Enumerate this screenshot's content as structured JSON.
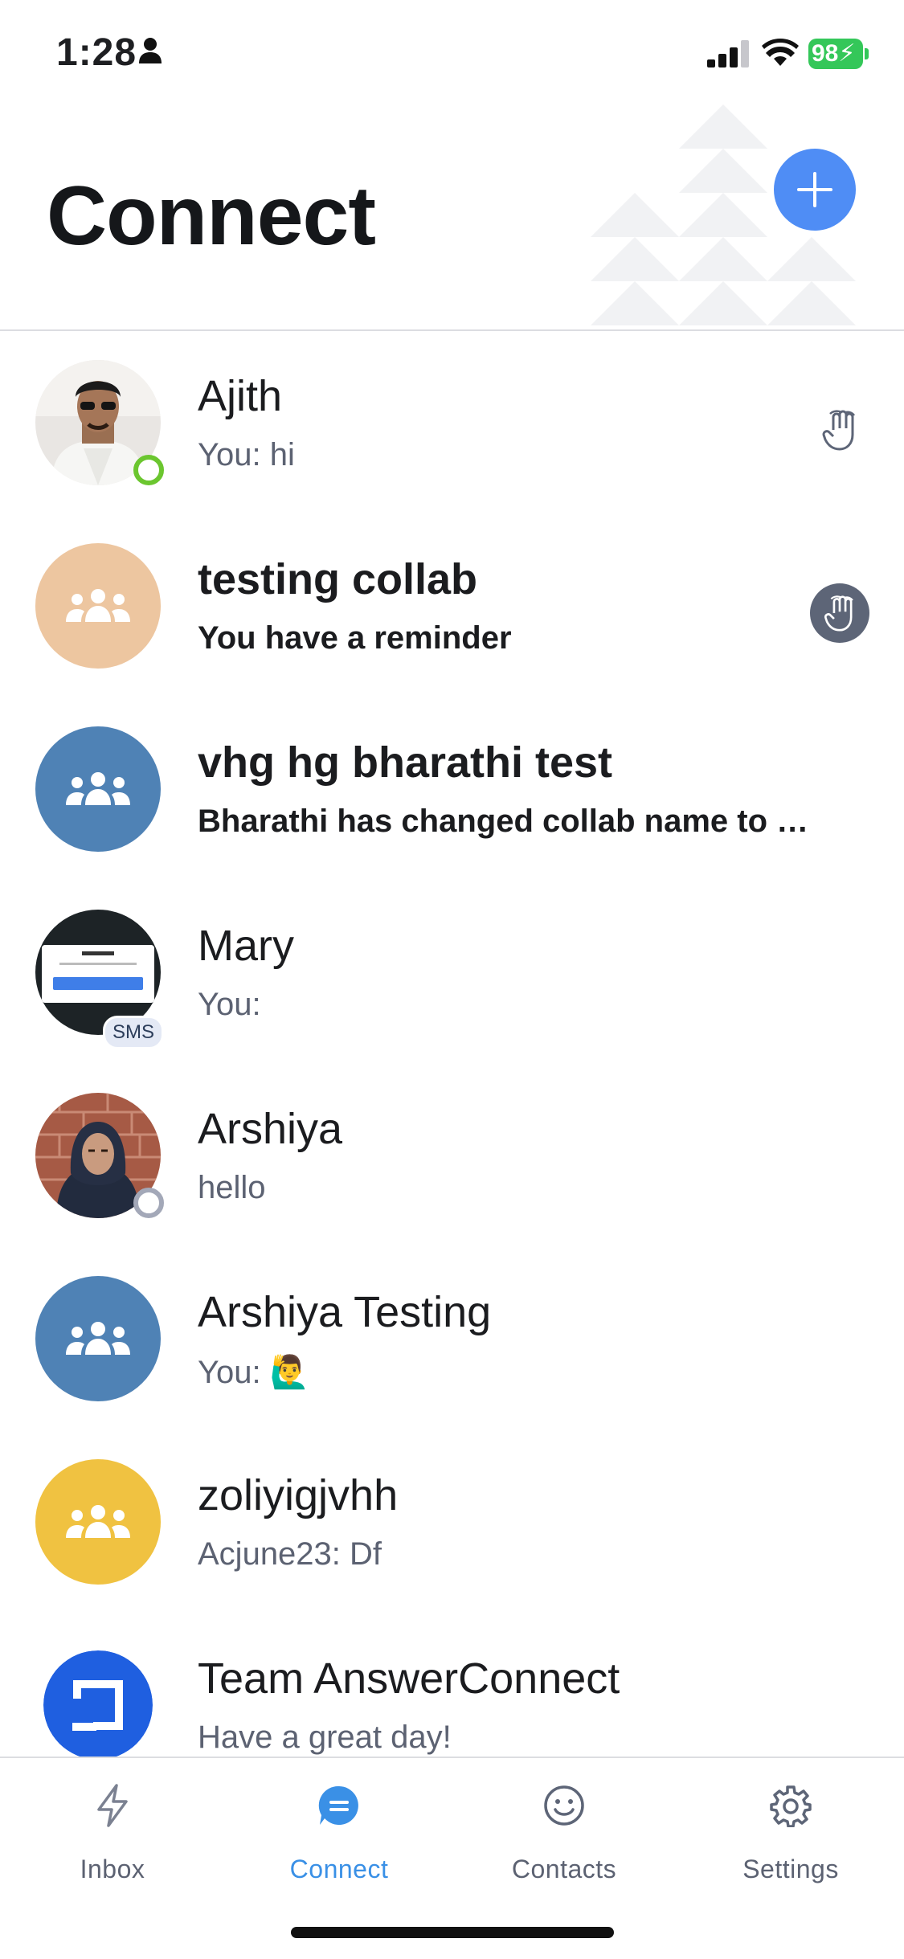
{
  "status_bar": {
    "time": "1:28",
    "battery": "98"
  },
  "header": {
    "title": "Connect"
  },
  "conversations": [
    {
      "name": "Ajith",
      "preview": "You: hi",
      "presence": "online"
    },
    {
      "name": "testing collab",
      "preview": "You have a reminder",
      "avatar_color": "#edc6a0"
    },
    {
      "name": "vhg hg bharathi test",
      "preview": "Bharathi has changed collab name to vh...",
      "avatar_color": "#4f82b5"
    },
    {
      "name": "Mary",
      "preview": "You:",
      "badge": "SMS"
    },
    {
      "name": "Arshiya",
      "preview": "hello",
      "presence": "away"
    },
    {
      "name": "Arshiya Testing",
      "preview": "You: 🙋‍♂️",
      "avatar_color": "#4f82b5"
    },
    {
      "name": "zoliyigjvhh",
      "preview": "Acjune23: Df",
      "avatar_color": "#f0c241"
    },
    {
      "name": "Team AnswerConnect",
      "preview": "Have a great day!",
      "avatar_color": "#1f5fe0"
    }
  ],
  "tabs": [
    {
      "label": "Inbox",
      "icon": "lightning-icon"
    },
    {
      "label": "Connect",
      "icon": "chat-bubble-icon",
      "active": true
    },
    {
      "label": "Contacts",
      "icon": "smiley-icon"
    },
    {
      "label": "Settings",
      "icon": "gear-icon"
    }
  ],
  "colors": {
    "accent": "#3a90e6",
    "fab": "#4f8df5",
    "online": "#6bc62f"
  }
}
